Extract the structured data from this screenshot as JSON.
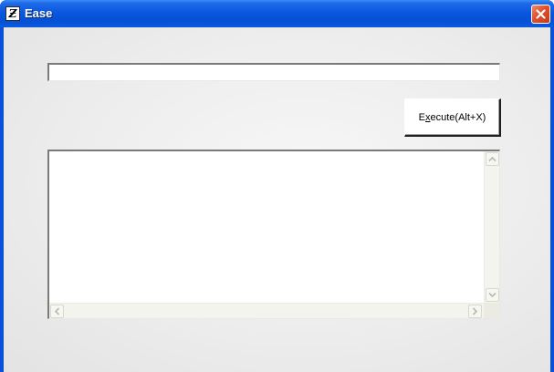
{
  "window": {
    "title": "Ease",
    "icon": "ease-app-icon",
    "icon_glyph": "Ƶ",
    "close_icon": "close-icon"
  },
  "command": {
    "value": "",
    "placeholder": ""
  },
  "execute_button": {
    "label_prefix": "E",
    "mnemonic": "x",
    "label_suffix": "ecute(Alt+X)"
  },
  "output": {
    "text": ""
  },
  "scrollbars": {
    "up_icon": "chevron-up-icon",
    "down_icon": "chevron-down-icon",
    "left_icon": "chevron-left-icon",
    "right_icon": "chevron-right-icon"
  }
}
